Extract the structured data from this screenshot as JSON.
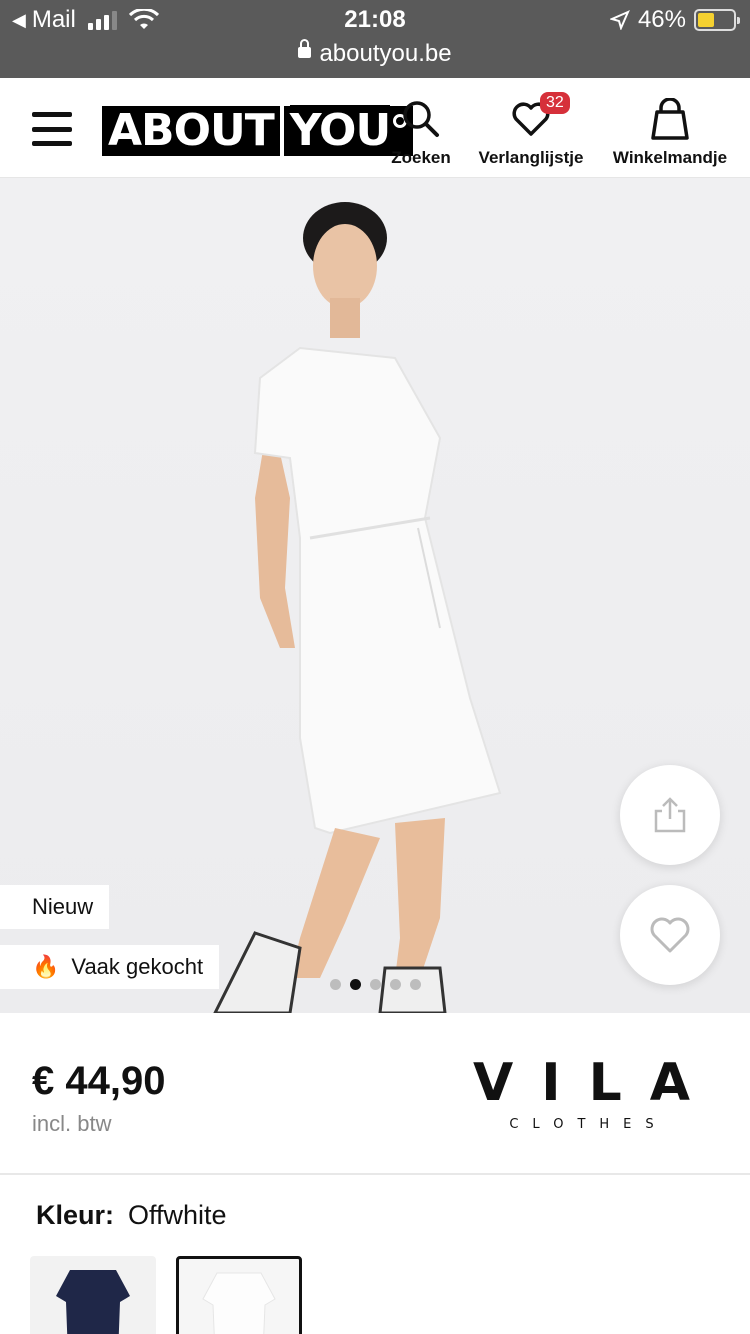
{
  "status_bar": {
    "back_app": "Mail",
    "time": "21:08",
    "battery": "46%",
    "battery_level": 0.46,
    "url": "aboutyou.be"
  },
  "header": {
    "logo_left": "ABOUT",
    "logo_right": "YOU",
    "search_label": "Zoeken",
    "wishlist_label": "Verlanglijstje",
    "wishlist_count": "32",
    "cart_label": "Winkelmandje",
    "icons": [
      "menu-icon",
      "search-icon",
      "heart-icon",
      "shopping-bag-icon"
    ]
  },
  "product": {
    "tags": [
      "Nieuw",
      "Vaak gekocht"
    ],
    "tag_icon": "fire-icon",
    "carousel": {
      "total": 5,
      "active_index": 1
    },
    "price": "€ 44,90",
    "price_note": "incl. btw",
    "brand_name": "VILA",
    "brand_sub": "CLOTHES",
    "color_label": "Kleur:",
    "color_value": "Offwhite"
  },
  "colors": {
    "accent": "#d6303a",
    "status_bar_bg": "#5a5a5a"
  }
}
